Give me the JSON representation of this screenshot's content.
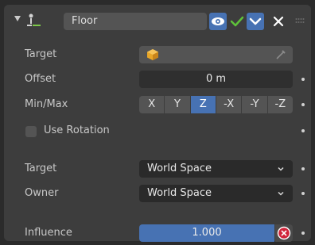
{
  "header": {
    "constraint_name": "Floor"
  },
  "rows": {
    "target_label": "Target",
    "offset_label": "Offset",
    "offset_value": "0 m",
    "minmax_label": "Min/Max",
    "axes": [
      "X",
      "Y",
      "Z",
      "-X",
      "-Y",
      "-Z"
    ],
    "selected_axis": "Z",
    "use_rotation_label": "Use Rotation",
    "use_rotation_checked": false,
    "space_target_label": "Target",
    "space_target_value": "World Space",
    "owner_label": "Owner",
    "owner_value": "World Space",
    "influence_label": "Influence",
    "influence_value": "1.000"
  },
  "colors": {
    "accent": "#4772b3",
    "panel": "#3d3d3d",
    "background": "#2b2b2b",
    "reset_red": "#d0243a",
    "check_green": "#5ec23a",
    "object_orange": "#e8a628"
  },
  "icons": [
    "expand-triangle-icon",
    "constraint-floor-icon",
    "eye-icon",
    "checkmark-icon",
    "chevron-down-icon",
    "close-icon",
    "drag-grip-icon",
    "object-icon",
    "eyedropper-icon",
    "reset-x-icon"
  ]
}
